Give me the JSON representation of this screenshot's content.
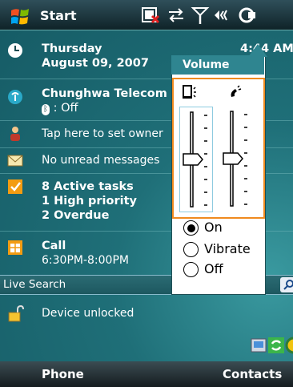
{
  "taskbar": {
    "start_label": "Start"
  },
  "clock": {
    "time": "4:44 AM"
  },
  "date": {
    "day": "Thursday",
    "full": "August 09, 2007"
  },
  "phone": {
    "carrier": "Chunghwa Telecom",
    "bluetooth": ": Off"
  },
  "owner": {
    "text": "Tap here to set owner"
  },
  "messages": {
    "text": "No unread messages"
  },
  "tasks": {
    "active": "8 Active tasks",
    "high": "1 High priority",
    "overdue": "2 Overdue"
  },
  "calendar": {
    "title": "Call",
    "time": "6:30PM-8:00PM"
  },
  "search": {
    "label": "Live Search"
  },
  "device": {
    "text": "Device unlocked"
  },
  "softkeys": {
    "left": "Phone",
    "right": "Contacts"
  },
  "volume": {
    "title": "Volume",
    "device_level": 0.5,
    "ringer_level": 0.5,
    "options": [
      "On",
      "Vibrate",
      "Off"
    ],
    "selected": "On"
  },
  "colors": {
    "accent_orange": "#f08a1e",
    "popup_header": "#2f8590"
  }
}
